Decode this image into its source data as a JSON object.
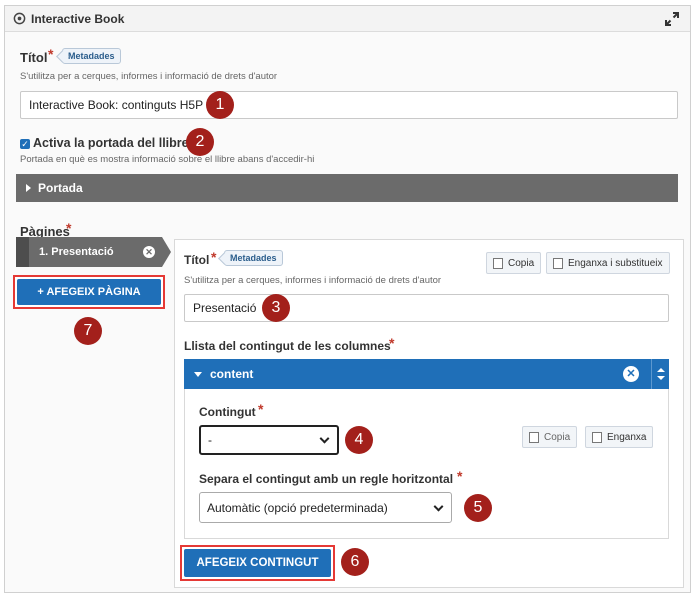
{
  "header": {
    "title": "Interactive Book",
    "icon": "h5p-gear-icon",
    "expand_icon": "expand-arrows-icon"
  },
  "title_field": {
    "label": "Títol",
    "metadata": "Metadades",
    "description": "S'utilitza per a cerques, informes i informació de drets d'autor",
    "value": "Interactive Book: continguts H5P"
  },
  "cover": {
    "label": "Activa la portada del llibre",
    "checked": true,
    "description": "Portada en què es mostra informació sobre el llibre abans d'accedir-hi",
    "group_label": "Portada"
  },
  "pages": {
    "label": "Pàgines",
    "tabs": [
      {
        "label": "1. Presentació"
      }
    ],
    "add_page": "+ AFEGEIX PÀGINA",
    "page_title": {
      "label": "Títol",
      "metadata": "Metadades",
      "description": "S'utilitza per a cerques, informes i informació de drets d'autor",
      "value": "Presentació"
    },
    "copy": "Copia",
    "paste_replace": "Enganxa i substitueix",
    "columns_label": "Llista del contingut de les columnes",
    "content_group": "content",
    "content": {
      "label": "Contingut",
      "selected": "-",
      "copy": "Copia",
      "paste": "Enganxa"
    },
    "separator": {
      "label": "Separa el contingut amb un regle horitzontal",
      "selected": "Automàtic (opció predeterminada)"
    },
    "add_content": "AFEGEIX CONTINGUT"
  },
  "callouts": [
    "1",
    "2",
    "3",
    "4",
    "5",
    "6",
    "7"
  ],
  "colors": {
    "accent_blue": "#1f6fb8",
    "callout_red": "#a3201b",
    "highlight_red": "#e53935",
    "group_gray": "#6b6b6b"
  }
}
